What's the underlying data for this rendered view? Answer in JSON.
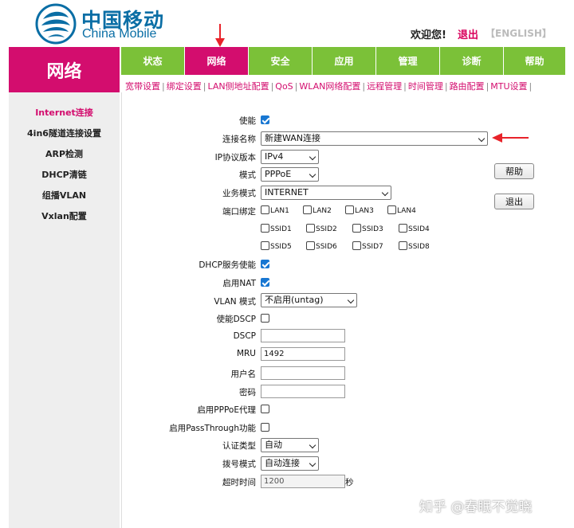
{
  "brand": {
    "name_cn": "中国移动",
    "name_en": "China Mobile",
    "color": "#0a6ea5"
  },
  "header": {
    "welcome": "欢迎您!",
    "logout": "退出",
    "language": "【ENGLISH】"
  },
  "section_title": "网络",
  "nav": {
    "tabs": [
      "状态",
      "网络",
      "安全",
      "应用",
      "管理",
      "诊断",
      "帮助"
    ],
    "active": "网络"
  },
  "subnav": [
    "宽带设置",
    "绑定设置",
    "LAN侧地址配置",
    "QoS",
    "WLAN网络配置",
    "远程管理",
    "时间管理",
    "路由配置",
    "MTU设置"
  ],
  "sidebar": {
    "items": [
      "Internet连接",
      "4in6隧道连接设置",
      "ARP检测",
      "DHCP清链",
      "组播VLAN",
      "Vxlan配置"
    ],
    "active": "Internet连接"
  },
  "form": {
    "enable_label": "使能",
    "enable_checked": true,
    "conn_name_label": "连接名称",
    "conn_name_value": "新建WAN连接",
    "ip_version_label": "IP协议版本",
    "ip_version_value": "IPv4",
    "mode_label": "模式",
    "mode_value": "PPPoE",
    "service_mode_label": "业务模式",
    "service_mode_value": "INTERNET",
    "port_binding_label": "端口绑定",
    "ports": [
      "LAN1",
      "LAN2",
      "LAN3",
      "LAN4",
      "SSID1",
      "SSID2",
      "SSID3",
      "SSID4",
      "SSID5",
      "SSID6",
      "SSID7",
      "SSID8"
    ],
    "dhcp_label": "DHCP服务使能",
    "dhcp_checked": true,
    "nat_label": "启用NAT",
    "nat_checked": true,
    "vlan_mode_label": "VLAN 模式",
    "vlan_mode_value": "不启用(untag)",
    "dscp_enable_label": "使能DSCP",
    "dscp_label": "DSCP",
    "dscp_value": "",
    "mru_label": "MRU",
    "mru_value": "1492",
    "username_label": "用户名",
    "username_value": "",
    "password_label": "密码",
    "password_value": "",
    "pppoe_proxy_label": "启用PPPoE代理",
    "passthrough_label": "启用PassThrough功能",
    "auth_type_label": "认证类型",
    "auth_type_value": "自动",
    "dial_mode_label": "拨号模式",
    "dial_mode_value": "自动连接",
    "timeout_label": "超时时间",
    "timeout_value": "1200",
    "timeout_unit": "秒"
  },
  "buttons": {
    "help": "帮助",
    "exit": "退出"
  },
  "watermark": "知乎 @春眠不觉晓",
  "colors": {
    "nav_green": "#7bc138",
    "magenta": "#d30d6e",
    "arrow_red": "#e8232a",
    "checkbox_blue": "#1877d2"
  }
}
